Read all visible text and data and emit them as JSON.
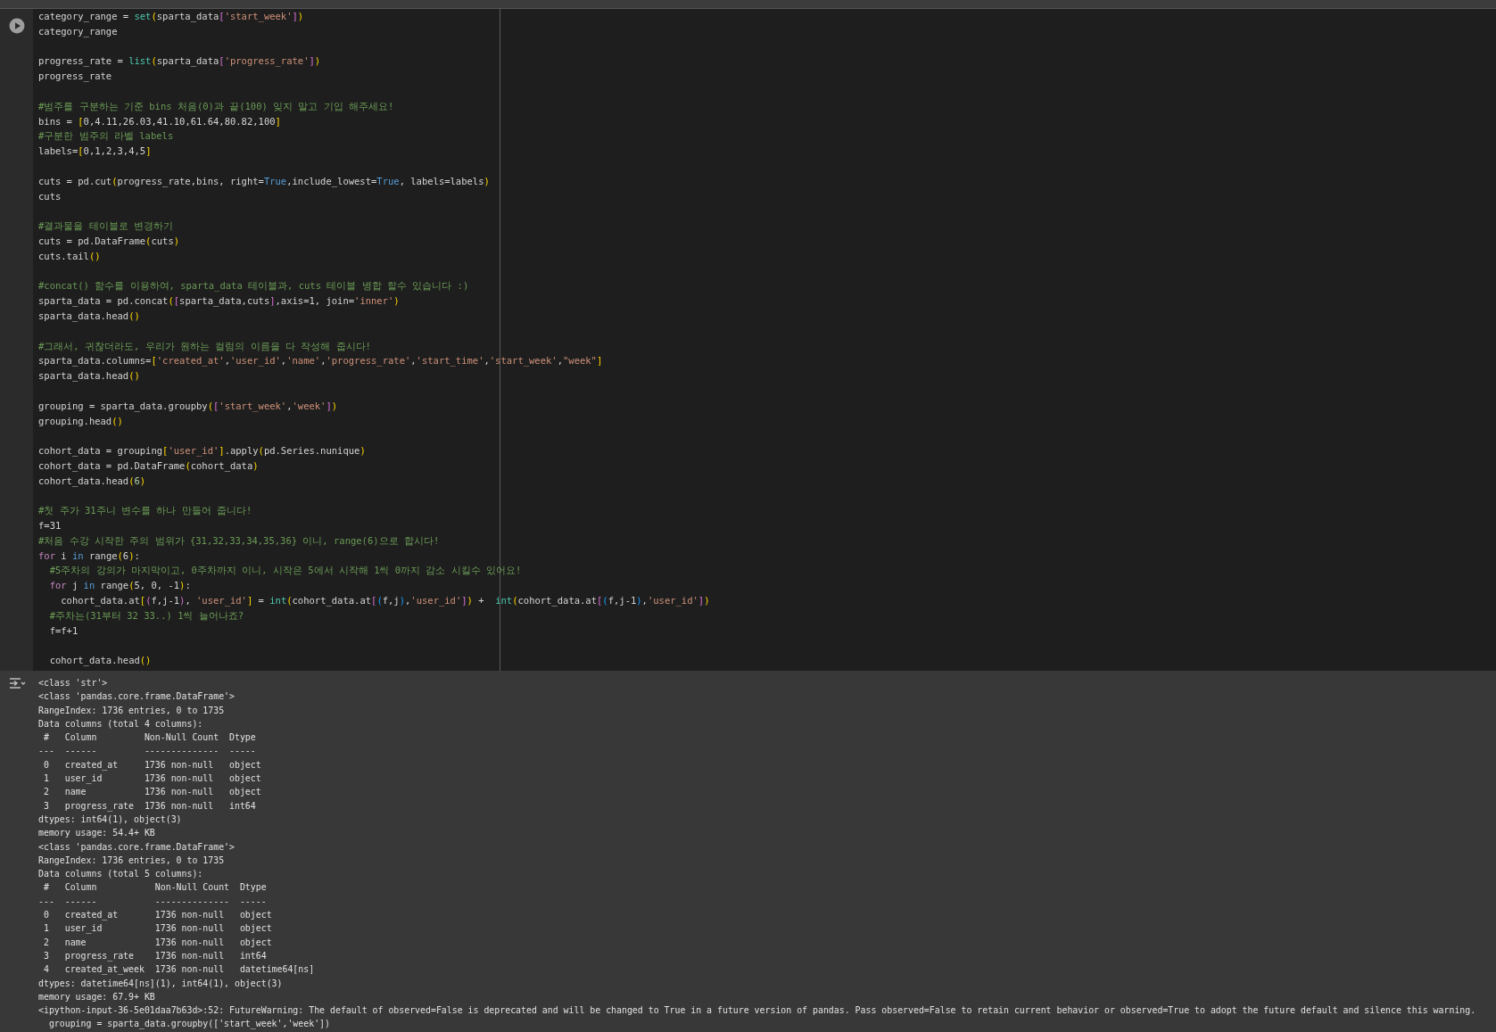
{
  "code_cell": {
    "blocks": [
      [
        [
          {
            "text": "category_range = ",
            "kind": "plain"
          },
          {
            "text": "set",
            "kind": "builtin"
          },
          {
            "text": "(",
            "kind": "b1"
          },
          {
            "text": "sparta_data",
            "kind": "plain"
          },
          {
            "text": "[",
            "kind": "b2"
          },
          {
            "text": "'start_week'",
            "kind": "string"
          },
          {
            "text": "]",
            "kind": "b2"
          },
          {
            "text": ")",
            "kind": "b1"
          }
        ],
        [
          {
            "text": "category_range",
            "kind": "plain"
          }
        ]
      ],
      [
        [
          {
            "text": "progress_rate = ",
            "kind": "plain"
          },
          {
            "text": "list",
            "kind": "builtin"
          },
          {
            "text": "(",
            "kind": "b1"
          },
          {
            "text": "sparta_data",
            "kind": "plain"
          },
          {
            "text": "[",
            "kind": "b2"
          },
          {
            "text": "'progress_rate'",
            "kind": "string"
          },
          {
            "text": "]",
            "kind": "b2"
          },
          {
            "text": ")",
            "kind": "b1"
          }
        ],
        [
          {
            "text": "progress_rate",
            "kind": "plain"
          }
        ]
      ],
      [
        [
          {
            "text": "#범주를 구분하는 기준 bins 처음(0)과 끝(100) 잊지 말고 기입 해주세요!",
            "kind": "comment"
          }
        ],
        [
          {
            "text": "bins = ",
            "kind": "plain"
          },
          {
            "text": "[",
            "kind": "b1"
          },
          {
            "text": "0,4.11,26.03,41.10,61.64,80.82,100",
            "kind": "plain"
          },
          {
            "text": "]",
            "kind": "b1"
          }
        ],
        [
          {
            "text": "#구분한 범주의 라벨 labels",
            "kind": "comment"
          }
        ],
        [
          {
            "text": "labels=",
            "kind": "plain"
          },
          {
            "text": "[",
            "kind": "b1"
          },
          {
            "text": "0,1,2,3,4,5",
            "kind": "plain"
          },
          {
            "text": "]",
            "kind": "b1"
          }
        ]
      ],
      [
        [
          {
            "text": "cuts = pd.cut",
            "kind": "plain"
          },
          {
            "text": "(",
            "kind": "b1"
          },
          {
            "text": "progress_rate,bins, right=",
            "kind": "plain"
          },
          {
            "text": "True",
            "kind": "keyword"
          },
          {
            "text": ",include_lowest=",
            "kind": "plain"
          },
          {
            "text": "True",
            "kind": "keyword"
          },
          {
            "text": ", labels=labels",
            "kind": "plain"
          },
          {
            "text": ")",
            "kind": "b1"
          }
        ],
        [
          {
            "text": "cuts",
            "kind": "plain"
          }
        ]
      ],
      [
        [
          {
            "text": "#결과물을 테이블로 변경하기",
            "kind": "comment"
          }
        ],
        [
          {
            "text": "cuts = pd.DataFrame",
            "kind": "plain"
          },
          {
            "text": "(",
            "kind": "b1"
          },
          {
            "text": "cuts",
            "kind": "plain"
          },
          {
            "text": ")",
            "kind": "b1"
          }
        ],
        [
          {
            "text": "cuts.tail",
            "kind": "plain"
          },
          {
            "text": "()",
            "kind": "b1"
          }
        ]
      ],
      [
        [
          {
            "text": "#concat() 함수를 이용하여, sparta_data 테이블과, cuts 테이블 병합 할수 있습니다 :)",
            "kind": "comment"
          }
        ],
        [
          {
            "text": "sparta_data = pd.concat",
            "kind": "plain"
          },
          {
            "text": "(",
            "kind": "b1"
          },
          {
            "text": "[",
            "kind": "b2"
          },
          {
            "text": "sparta_data,cuts",
            "kind": "plain"
          },
          {
            "text": "]",
            "kind": "b2"
          },
          {
            "text": ",axis=1, join=",
            "kind": "plain"
          },
          {
            "text": "'inner'",
            "kind": "string"
          },
          {
            "text": ")",
            "kind": "b1"
          }
        ],
        [
          {
            "text": "sparta_data.head",
            "kind": "plain"
          },
          {
            "text": "()",
            "kind": "b1"
          }
        ]
      ],
      [
        [
          {
            "text": "#그래서, 귀찮더라도, 우리가 원하는 컬럼의 이름을 다 작성해 줍시다!",
            "kind": "comment"
          }
        ],
        [
          {
            "text": "sparta_data.columns=",
            "kind": "plain"
          },
          {
            "text": "[",
            "kind": "b1"
          },
          {
            "text": "'created_at'",
            "kind": "string"
          },
          {
            "text": ",",
            "kind": "plain"
          },
          {
            "text": "'user_id'",
            "kind": "string"
          },
          {
            "text": ",",
            "kind": "plain"
          },
          {
            "text": "'name'",
            "kind": "string"
          },
          {
            "text": ",",
            "kind": "plain"
          },
          {
            "text": "'progress_rate'",
            "kind": "string"
          },
          {
            "text": ",",
            "kind": "plain"
          },
          {
            "text": "'start_time'",
            "kind": "string"
          },
          {
            "text": ",",
            "kind": "plain"
          },
          {
            "text": "'start_week'",
            "kind": "string"
          },
          {
            "text": ",",
            "kind": "plain"
          },
          {
            "text": "\"week\"",
            "kind": "string"
          },
          {
            "text": "]",
            "kind": "b1"
          }
        ],
        [
          {
            "text": "sparta_data.head",
            "kind": "plain"
          },
          {
            "text": "()",
            "kind": "b1"
          }
        ]
      ],
      [
        [
          {
            "text": "grouping = sparta_data.groupby",
            "kind": "plain"
          },
          {
            "text": "(",
            "kind": "b1"
          },
          {
            "text": "[",
            "kind": "b2"
          },
          {
            "text": "'start_week'",
            "kind": "string"
          },
          {
            "text": ",",
            "kind": "plain"
          },
          {
            "text": "'week'",
            "kind": "string"
          },
          {
            "text": "]",
            "kind": "b2"
          },
          {
            "text": ")",
            "kind": "b1"
          }
        ],
        [
          {
            "text": "grouping.head",
            "kind": "plain"
          },
          {
            "text": "()",
            "kind": "b1"
          }
        ]
      ],
      [
        [
          {
            "text": "cohort_data = grouping",
            "kind": "plain"
          },
          {
            "text": "[",
            "kind": "b1"
          },
          {
            "text": "'user_id'",
            "kind": "string"
          },
          {
            "text": "]",
            "kind": "b1"
          },
          {
            "text": ".apply",
            "kind": "plain"
          },
          {
            "text": "(",
            "kind": "b1"
          },
          {
            "text": "pd.Series.nunique",
            "kind": "plain"
          },
          {
            "text": ")",
            "kind": "b1"
          }
        ],
        [
          {
            "text": "cohort_data = pd.DataFrame",
            "kind": "plain"
          },
          {
            "text": "(",
            "kind": "b1"
          },
          {
            "text": "cohort_data",
            "kind": "plain"
          },
          {
            "text": ")",
            "kind": "b1"
          }
        ],
        [
          {
            "text": "cohort_data.head",
            "kind": "plain"
          },
          {
            "text": "(",
            "kind": "b1"
          },
          {
            "text": "6",
            "kind": "number"
          },
          {
            "text": ")",
            "kind": "b1"
          }
        ]
      ],
      [
        [
          {
            "text": "#첫 주가 31주니 변수를 하나 만들어 줍니다!",
            "kind": "comment"
          }
        ],
        [
          {
            "text": "f=31",
            "kind": "plain"
          }
        ],
        [
          {
            "text": "#처음 수강 시작한 주의 범위가 {31,32,33,34,35,36} 이니, range(6)으로 합시다!",
            "kind": "comment"
          }
        ],
        [
          {
            "text": "for",
            "kind": "control"
          },
          {
            "text": " i ",
            "kind": "plain"
          },
          {
            "text": "in",
            "kind": "keyword"
          },
          {
            "text": " range",
            "kind": "plain"
          },
          {
            "text": "(",
            "kind": "b1"
          },
          {
            "text": "6",
            "kind": "plain"
          },
          {
            "text": ")",
            "kind": "b1"
          },
          {
            "text": ":",
            "kind": "plain"
          }
        ],
        [
          {
            "text": "  #5주차의 강의가 마지막이고, 0주차까지 이니, 시작은 5에서 시작해 1씩 0까지 감소 시킬수 있어요!",
            "kind": "comment"
          }
        ],
        [
          {
            "text": "  for",
            "kind": "control"
          },
          {
            "text": " j ",
            "kind": "plain"
          },
          {
            "text": "in",
            "kind": "keyword"
          },
          {
            "text": " range",
            "kind": "plain"
          },
          {
            "text": "(",
            "kind": "b1"
          },
          {
            "text": "5, 0, -1",
            "kind": "plain"
          },
          {
            "text": ")",
            "kind": "b1"
          },
          {
            "text": ":",
            "kind": "plain"
          }
        ],
        [
          {
            "text": "    cohort_data.at",
            "kind": "plain"
          },
          {
            "text": "[",
            "kind": "b1"
          },
          {
            "text": "(",
            "kind": "b2"
          },
          {
            "text": "f,j-1",
            "kind": "plain"
          },
          {
            "text": ")",
            "kind": "b2"
          },
          {
            "text": ", ",
            "kind": "plain"
          },
          {
            "text": "'user_id'",
            "kind": "string"
          },
          {
            "text": "]",
            "kind": "b1"
          },
          {
            "text": " = ",
            "kind": "plain"
          },
          {
            "text": "int",
            "kind": "builtin"
          },
          {
            "text": "(",
            "kind": "b1"
          },
          {
            "text": "cohort_data.at",
            "kind": "plain"
          },
          {
            "text": "[",
            "kind": "b2"
          },
          {
            "text": "(",
            "kind": "b3"
          },
          {
            "text": "f,j",
            "kind": "plain"
          },
          {
            "text": ")",
            "kind": "b3"
          },
          {
            "text": ",",
            "kind": "plain"
          },
          {
            "text": "'user_id'",
            "kind": "string"
          },
          {
            "text": "]",
            "kind": "b2"
          },
          {
            "text": ")",
            "kind": "b1"
          },
          {
            "text": " +  ",
            "kind": "plain"
          },
          {
            "text": "int",
            "kind": "builtin"
          },
          {
            "text": "(",
            "kind": "b1"
          },
          {
            "text": "cohort_data.at",
            "kind": "plain"
          },
          {
            "text": "[",
            "kind": "b2"
          },
          {
            "text": "(",
            "kind": "b3"
          },
          {
            "text": "f,j-1",
            "kind": "plain"
          },
          {
            "text": ")",
            "kind": "b3"
          },
          {
            "text": ",",
            "kind": "plain"
          },
          {
            "text": "'user_id'",
            "kind": "string"
          },
          {
            "text": "]",
            "kind": "b2"
          },
          {
            "text": ")",
            "kind": "b1"
          }
        ],
        [
          {
            "text": "  #주차는(31부터 32 33..) 1씩 늘어나죠?",
            "kind": "comment"
          }
        ],
        [
          {
            "text": "  f=f+1",
            "kind": "plain"
          }
        ]
      ],
      [
        [
          {
            "text": "  cohort_data.head",
            "kind": "plain"
          },
          {
            "text": "()",
            "kind": "b1"
          }
        ]
      ]
    ]
  },
  "output_lines": [
    "<class 'str'>",
    "<class 'pandas.core.frame.DataFrame'>",
    "RangeIndex: 1736 entries, 0 to 1735",
    "Data columns (total 4 columns):",
    " #   Column         Non-Null Count  Dtype ",
    "---  ------         --------------  ----- ",
    " 0   created_at     1736 non-null   object",
    " 1   user_id        1736 non-null   object",
    " 2   name           1736 non-null   object",
    " 3   progress_rate  1736 non-null   int64 ",
    "dtypes: int64(1), object(3)",
    "memory usage: 54.4+ KB",
    "<class 'pandas.core.frame.DataFrame'>",
    "RangeIndex: 1736 entries, 0 to 1735",
    "Data columns (total 5 columns):",
    " #   Column           Non-Null Count  Dtype         ",
    "---  ------           --------------  -----         ",
    " 0   created_at       1736 non-null   object        ",
    " 1   user_id          1736 non-null   object        ",
    " 2   name             1736 non-null   object        ",
    " 3   progress_rate    1736 non-null   int64         ",
    " 4   created_at_week  1736 non-null   datetime64[ns]",
    "dtypes: datetime64[ns](1), int64(1), object(3)",
    "memory usage: 67.9+ KB",
    "<ipython-input-36-5e01daa7b63d>:52: FutureWarning: The default of observed=False is deprecated and will be changed to True in a future version of pandas. Pass observed=False to retain current behavior or observed=True to adopt the future default and silence this warning.",
    "  grouping = sparta_data.groupby(['start_week','week'])"
  ]
}
